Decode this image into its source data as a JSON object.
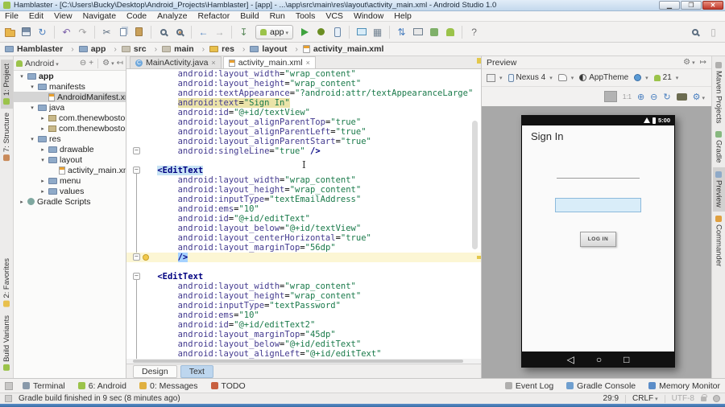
{
  "window": {
    "title": "Hamblaster - [C:\\Users\\Bucky\\Desktop\\Android_Projects\\Hamblaster] - [app] - ...\\app\\src\\main\\res\\layout\\activity_main.xml - Android Studio 1.0"
  },
  "menu": [
    "File",
    "Edit",
    "View",
    "Navigate",
    "Code",
    "Analyze",
    "Refactor",
    "Build",
    "Run",
    "Tools",
    "VCS",
    "Window",
    "Help"
  ],
  "toolbar": {
    "run_config": "app",
    "items": [
      {
        "n": "open-icon",
        "s": "folder"
      },
      {
        "n": "save-all-icon",
        "s": "disk"
      },
      {
        "n": "synchronize-icon",
        "g": "↻",
        "c": "#4A7FBF"
      },
      {
        "sep": true
      },
      {
        "n": "undo-icon",
        "g": "↶",
        "c": "#7A5FA8"
      },
      {
        "n": "redo-icon",
        "g": "↷",
        "c": "#A0A0A0"
      },
      {
        "sep": true
      },
      {
        "n": "cut-icon",
        "g": "✂",
        "c": "#5C6E80"
      },
      {
        "n": "copy-icon",
        "s": "copy"
      },
      {
        "n": "paste-icon",
        "s": "paste"
      },
      {
        "sep": true
      },
      {
        "n": "find-icon",
        "s": "mag"
      },
      {
        "n": "replace-icon",
        "s": "mag r"
      },
      {
        "sep": true
      },
      {
        "n": "back-icon",
        "g": "←",
        "c": "#4A7FBF"
      },
      {
        "n": "forward-icon",
        "g": "→",
        "c": "#A8A8A8"
      },
      {
        "sep": true
      },
      {
        "n": "make-project-icon",
        "g": "↧",
        "c": "#5C8A5C"
      },
      {
        "combo": true
      },
      {
        "n": "run-icon",
        "s": "tri"
      },
      {
        "n": "debug-icon",
        "s": "bug"
      },
      {
        "n": "attach-debugger-icon",
        "s": "phone"
      },
      {
        "sep": true
      },
      {
        "n": "avd-manager-icon",
        "s": "device"
      },
      {
        "n": "project-structure-icon",
        "g": "▦",
        "c": "#708090"
      },
      {
        "sep": true
      },
      {
        "n": "gradle-sync-icon",
        "g": "⇅",
        "c": "#4A7FBF"
      },
      {
        "n": "android-monitor-icon",
        "s": "monitor"
      },
      {
        "n": "build-variants-icon",
        "s": "greenbox"
      },
      {
        "n": "sdk-manager-icon",
        "s": "robot"
      },
      {
        "sep": true
      },
      {
        "n": "help-icon",
        "g": "?",
        "c": "#707070"
      }
    ]
  },
  "breadcrumbs": [
    {
      "label": "Hamblaster",
      "icon": "folder-b"
    },
    {
      "label": "app",
      "icon": "folder-b"
    },
    {
      "label": "src",
      "icon": "folder-p"
    },
    {
      "label": "main",
      "icon": "folder-p"
    },
    {
      "label": "res",
      "icon": "folder-y"
    },
    {
      "label": "layout",
      "icon": "folder-b"
    },
    {
      "label": "activity_main.xml",
      "icon": "file-o"
    }
  ],
  "left_strip": {
    "top": [
      {
        "label": "1: Project",
        "active": true,
        "color": "#9BC34A"
      },
      {
        "label": "7: Structure",
        "active": false,
        "color": "#C98A5A"
      }
    ],
    "bottom": [
      {
        "label": "2: Favorites",
        "active": false,
        "color": "#E8C04C"
      },
      {
        "label": "Build Variants",
        "active": false,
        "color": "#9BC34A"
      }
    ]
  },
  "right_strip": [
    {
      "label": "Maven Projects",
      "active": false,
      "color": "#B0AFAE"
    },
    {
      "label": "Gradle",
      "active": false,
      "color": "#87B87F"
    },
    {
      "label": "Preview",
      "active": true,
      "color": "#8FAAC8"
    },
    {
      "label": "Commander",
      "active": false,
      "color": "#E0A040"
    }
  ],
  "project": {
    "view": "Android",
    "tree": [
      {
        "label": "app",
        "depth": 0,
        "chev": "v",
        "icon": "folder",
        "bold": true
      },
      {
        "label": "manifests",
        "depth": 1,
        "chev": "v",
        "icon": "folder"
      },
      {
        "label": "AndroidManifest.xml",
        "depth": 2,
        "chev": "",
        "icon": "file",
        "selected": true
      },
      {
        "label": "java",
        "depth": 1,
        "chev": "v",
        "icon": "folder"
      },
      {
        "label": "com.thenewboston.hamblaster",
        "depth": 2,
        "chev": "r",
        "icon": "pkg"
      },
      {
        "label": "com.thenewboston.hamblaster",
        "depth": 2,
        "chev": "r",
        "icon": "pkg"
      },
      {
        "label": "res",
        "depth": 1,
        "chev": "v",
        "icon": "folder"
      },
      {
        "label": "drawable",
        "depth": 2,
        "chev": "r",
        "icon": "folder"
      },
      {
        "label": "layout",
        "depth": 2,
        "chev": "v",
        "icon": "folder"
      },
      {
        "label": "activity_main.xml",
        "depth": 3,
        "chev": "",
        "icon": "file"
      },
      {
        "label": "menu",
        "depth": 2,
        "chev": "r",
        "icon": "folder"
      },
      {
        "label": "values",
        "depth": 2,
        "chev": "r",
        "icon": "folder"
      },
      {
        "label": "Gradle Scripts",
        "depth": 0,
        "chev": "r",
        "icon": "gradle"
      }
    ]
  },
  "editor": {
    "tabs": [
      {
        "label": "MainActivity.java",
        "icon": "class",
        "active": false
      },
      {
        "label": "activity_main.xml",
        "icon": "xml",
        "active": true
      }
    ],
    "bottom_tabs": [
      {
        "label": "Design",
        "active": false
      },
      {
        "label": "Text",
        "active": true
      }
    ],
    "lines": [
      {
        "seg": [
          [
            "s",
            "     "
          ],
          [
            "a",
            "android:layout_width"
          ],
          [
            "p",
            "="
          ],
          [
            "v",
            "\"wrap_content\""
          ]
        ]
      },
      {
        "seg": [
          [
            "s",
            "     "
          ],
          [
            "a",
            "android:layout_height"
          ],
          [
            "p",
            "="
          ],
          [
            "v",
            "\"wrap_content\""
          ]
        ]
      },
      {
        "seg": [
          [
            "s",
            "     "
          ],
          [
            "a",
            "android:textAppearance"
          ],
          [
            "p",
            "="
          ],
          [
            "v",
            "\"?android:attr/textAppearanceLarge\""
          ]
        ]
      },
      {
        "hl": "usage",
        "seg": [
          [
            "s",
            "     "
          ],
          [
            "a",
            "android:text"
          ],
          [
            "p",
            "="
          ],
          [
            "v",
            "\"Sign In\""
          ]
        ]
      },
      {
        "seg": [
          [
            "s",
            "     "
          ],
          [
            "a",
            "android:id"
          ],
          [
            "p",
            "="
          ],
          [
            "v",
            "\"@+id/textView\""
          ]
        ]
      },
      {
        "seg": [
          [
            "s",
            "     "
          ],
          [
            "a",
            "android:layout_alignParentTop"
          ],
          [
            "p",
            "="
          ],
          [
            "v",
            "\"true\""
          ]
        ]
      },
      {
        "seg": [
          [
            "s",
            "     "
          ],
          [
            "a",
            "android:layout_alignParentLeft"
          ],
          [
            "p",
            "="
          ],
          [
            "v",
            "\"true\""
          ]
        ]
      },
      {
        "seg": [
          [
            "s",
            "     "
          ],
          [
            "a",
            "android:layout_alignParentStart"
          ],
          [
            "p",
            "="
          ],
          [
            "v",
            "\"true\""
          ]
        ]
      },
      {
        "g": "fold",
        "seg": [
          [
            "s",
            "     "
          ],
          [
            "a",
            "android:singleLine"
          ],
          [
            "p",
            "="
          ],
          [
            "v",
            "\"true\""
          ],
          [
            "t",
            " />"
          ]
        ]
      },
      {
        "seg": []
      },
      {
        "g": "fold",
        "seg": [
          [
            "s",
            " "
          ],
          [
            "tm",
            "<EditText"
          ]
        ]
      },
      {
        "seg": [
          [
            "s",
            "     "
          ],
          [
            "a",
            "android:layout_width"
          ],
          [
            "p",
            "="
          ],
          [
            "v",
            "\"wrap_content\""
          ]
        ]
      },
      {
        "seg": [
          [
            "s",
            "     "
          ],
          [
            "a",
            "android:layout_height"
          ],
          [
            "p",
            "="
          ],
          [
            "v",
            "\"wrap_content\""
          ]
        ]
      },
      {
        "seg": [
          [
            "s",
            "     "
          ],
          [
            "a",
            "android:inputType"
          ],
          [
            "p",
            "="
          ],
          [
            "v",
            "\"textEmailAddress\""
          ]
        ]
      },
      {
        "seg": [
          [
            "s",
            "     "
          ],
          [
            "a",
            "android:ems"
          ],
          [
            "p",
            "="
          ],
          [
            "v",
            "\"10\""
          ]
        ]
      },
      {
        "seg": [
          [
            "s",
            "     "
          ],
          [
            "a",
            "android:id"
          ],
          [
            "p",
            "="
          ],
          [
            "v",
            "\"@+id/editText\""
          ]
        ]
      },
      {
        "seg": [
          [
            "s",
            "     "
          ],
          [
            "a",
            "android:layout_below"
          ],
          [
            "p",
            "="
          ],
          [
            "v",
            "\"@+id/textView\""
          ]
        ]
      },
      {
        "seg": [
          [
            "s",
            "     "
          ],
          [
            "a",
            "android:layout_centerHorizontal"
          ],
          [
            "p",
            "="
          ],
          [
            "v",
            "\"true\""
          ]
        ]
      },
      {
        "seg": [
          [
            "s",
            "     "
          ],
          [
            "a",
            "android:layout_marginTop"
          ],
          [
            "p",
            "="
          ],
          [
            "v",
            "\"56dp\""
          ]
        ]
      },
      {
        "g": "bulb",
        "hl": "current",
        "seg": [
          [
            "s",
            "     "
          ],
          [
            "x",
            "/>"
          ]
        ]
      },
      {
        "seg": []
      },
      {
        "g": "fold",
        "seg": [
          [
            "s",
            " "
          ],
          [
            "t",
            "<EditText"
          ]
        ]
      },
      {
        "seg": [
          [
            "s",
            "     "
          ],
          [
            "a",
            "android:layout_width"
          ],
          [
            "p",
            "="
          ],
          [
            "v",
            "\"wrap_content\""
          ]
        ]
      },
      {
        "seg": [
          [
            "s",
            "     "
          ],
          [
            "a",
            "android:layout_height"
          ],
          [
            "p",
            "="
          ],
          [
            "v",
            "\"wrap_content\""
          ]
        ]
      },
      {
        "seg": [
          [
            "s",
            "     "
          ],
          [
            "a",
            "android:inputType"
          ],
          [
            "p",
            "="
          ],
          [
            "v",
            "\"textPassword\""
          ]
        ]
      },
      {
        "seg": [
          [
            "s",
            "     "
          ],
          [
            "a",
            "android:ems"
          ],
          [
            "p",
            "="
          ],
          [
            "v",
            "\"10\""
          ]
        ]
      },
      {
        "seg": [
          [
            "s",
            "     "
          ],
          [
            "a",
            "android:id"
          ],
          [
            "p",
            "="
          ],
          [
            "v",
            "\"@+id/editText2\""
          ]
        ]
      },
      {
        "seg": [
          [
            "s",
            "     "
          ],
          [
            "a",
            "android:layout_marginTop"
          ],
          [
            "p",
            "="
          ],
          [
            "v",
            "\"45dp\""
          ]
        ]
      },
      {
        "seg": [
          [
            "s",
            "     "
          ],
          [
            "a",
            "android:layout_below"
          ],
          [
            "p",
            "="
          ],
          [
            "v",
            "\"@+id/editText\""
          ]
        ]
      },
      {
        "seg": [
          [
            "s",
            "     "
          ],
          [
            "a",
            "android:layout_alignLeft"
          ],
          [
            "p",
            "="
          ],
          [
            "v",
            "\"@+id/editText\""
          ]
        ]
      }
    ]
  },
  "preview": {
    "header": "Preview",
    "device": "Nexus 4",
    "theme": "AppTheme",
    "api_level": "21",
    "phone": {
      "time": "5:00",
      "title": "Sign In",
      "button": "LOG IN"
    }
  },
  "bottom_bar": {
    "left": [
      {
        "label": "Terminal",
        "color": "#8899AA"
      },
      {
        "label": "6: Android",
        "color": "#9BC34A"
      },
      {
        "label": "0: Messages",
        "color": "#E0B040"
      },
      {
        "label": "TODO",
        "color": "#C86040"
      }
    ],
    "right": [
      {
        "label": "Event Log",
        "color": "#B0AFAE"
      },
      {
        "label": "Gradle Console",
        "color": "#6F9FCF"
      },
      {
        "label": "Memory Monitor",
        "color": "#5B8DC8"
      }
    ]
  },
  "status_bar": {
    "message": "Gradle build finished in 9 sec (8 minutes ago)",
    "position": "29:9",
    "line_ending": "CRLF",
    "encoding": "UTF-8"
  }
}
